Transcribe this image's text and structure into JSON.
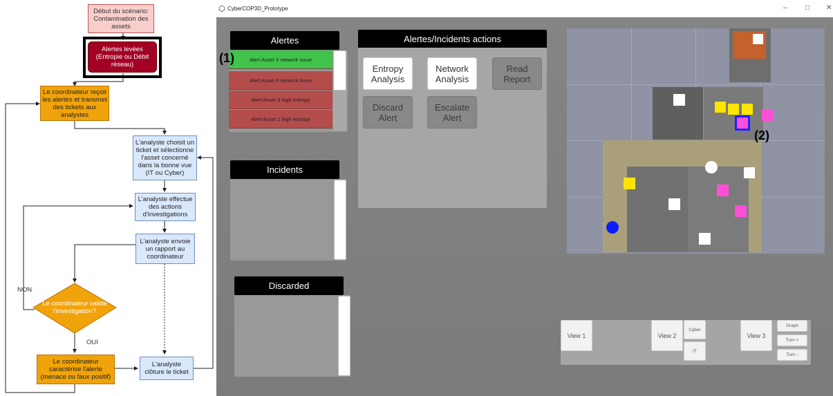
{
  "flowchart": {
    "start": "Début du scénario: Contamination des assets",
    "alerts_raised": "Alertes levées (Entropie ou Débit réseau)",
    "coordinator_receives": "Le coordinateur reçoit les alertes et transmet des tickets aux analystes",
    "analyst_chooses": "L'analyste choisit un ticket et sélectionne l'asset concerné dans la bonne vue (IT ou Cyber)",
    "analyst_investigates": "L'analyste effectue des actions d'investigations",
    "analyst_reports": "L'analyste envoie un rapport au coordinateur",
    "coordinator_validates": "Le coordinateur valide l'investigation?",
    "coordinator_characterizes": "Le coordinateur caractérise l'alerte (menace ou faux positif)",
    "analyst_closes": "L'analyste clôture le ticket",
    "label_no": "NON",
    "label_yes": "OUI"
  },
  "window": {
    "title": "CyberCOP3D_Prototype",
    "minimize": "–",
    "maximize": "□",
    "close": "✕"
  },
  "alerts_panel": {
    "header": "Alertes",
    "items": [
      {
        "label": "Alert Asset 3 network issue",
        "state": "selected"
      },
      {
        "label": "Alert Asset 6 network issue",
        "state": "normal"
      },
      {
        "label": "Alert Asset 9 high entropy",
        "state": "normal"
      },
      {
        "label": "Alert Asset 1 high entropy",
        "state": "normal"
      }
    ]
  },
  "incidents_panel": {
    "header": "Incidents"
  },
  "discarded_panel": {
    "header": "Discarded"
  },
  "actions_panel": {
    "header": "Alertes/Incidents actions",
    "buttons": {
      "entropy": "Entropy Analysis",
      "network": "Network Analysis",
      "read_report": "Read Report",
      "discard": "Discard Alert",
      "escalate": "Escalate Alert"
    }
  },
  "callouts": {
    "one": "(1)",
    "two": "(2)"
  },
  "view_controls": {
    "view1": "View 1",
    "view2": "View 2",
    "cyber": "Cyber",
    "it": "IT",
    "view3": "View 3",
    "graph": "Graph",
    "turn_plus": "Turn +",
    "turn_minus": "Turn -"
  },
  "colors": {
    "alert_selected": "#3fc34a",
    "alert_normal": "#b54c4c",
    "marker_yellow": "#ffe600",
    "marker_pink": "#ff4fd8",
    "marker_white": "#ffffff",
    "marker_blue": "#0a1fff",
    "flow_orange": "#f0a30a",
    "flow_blue": "#dae8fc",
    "flow_red": "#a20025"
  }
}
